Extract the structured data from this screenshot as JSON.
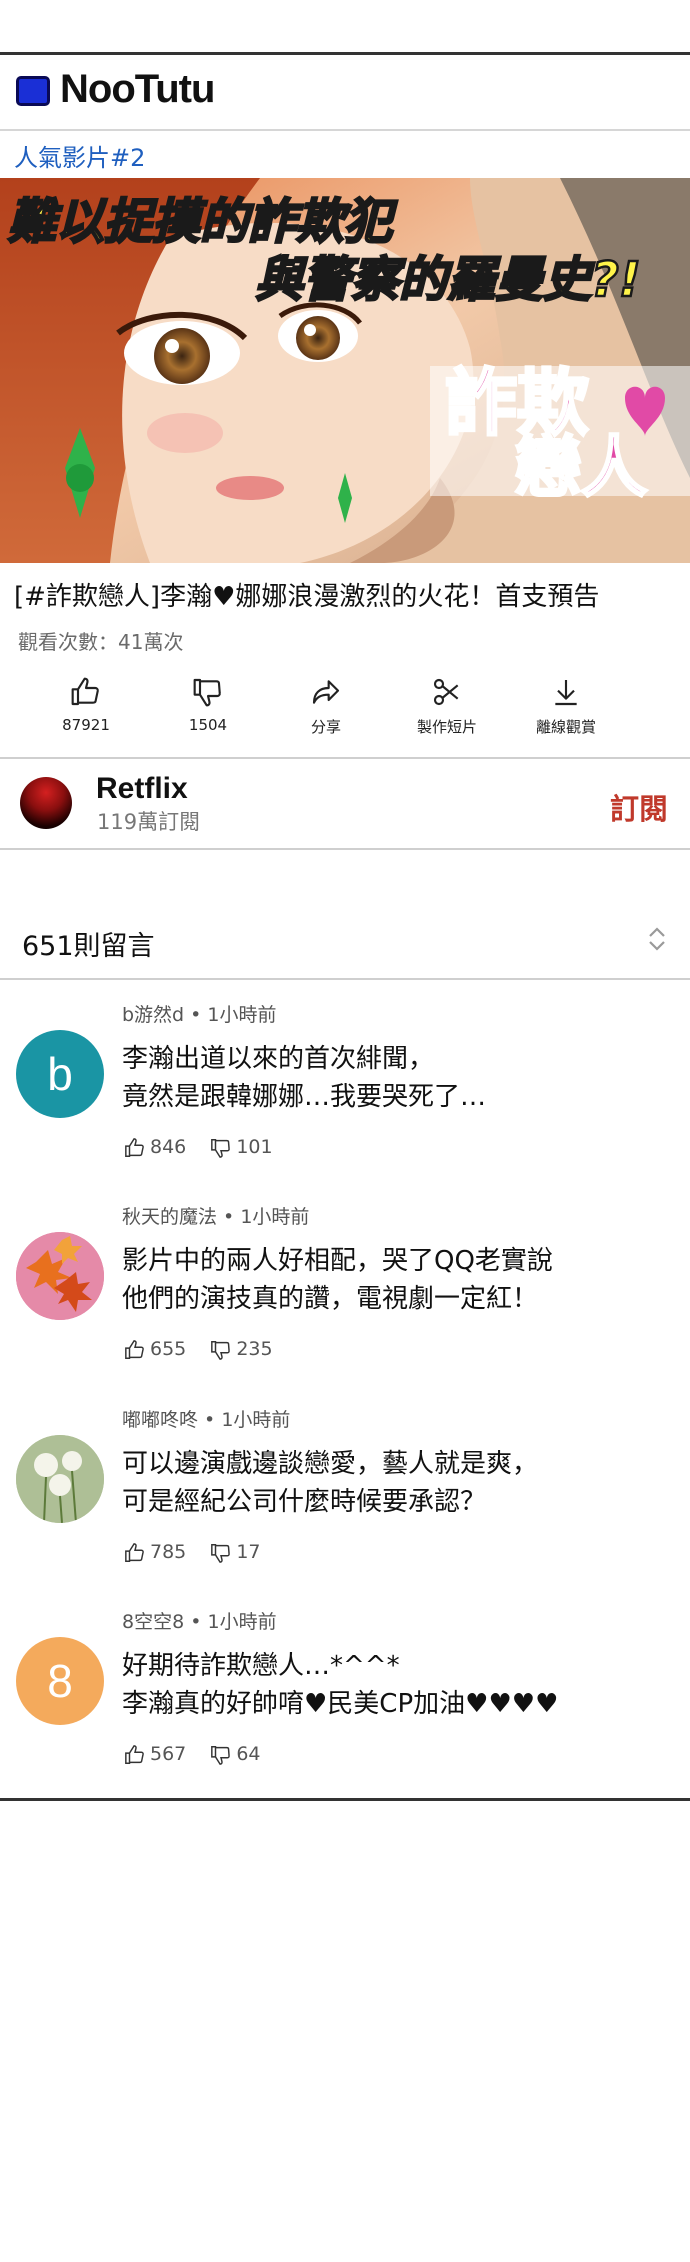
{
  "app": {
    "title": "NooTutu"
  },
  "section": {
    "label": "人氣影片#2"
  },
  "hero": {
    "headline_line1": "難以捉摸的詐欺犯",
    "headline_line2": "與警察的羅曼史?!",
    "logo_line1": "詐欺",
    "logo_line2": "戀人"
  },
  "video": {
    "title": "[#詐欺戀人]李瀚♥娜娜浪漫激烈的火花！首支預告",
    "views": "觀看次數：41萬次"
  },
  "actions": [
    {
      "icon": "thumbs-up-icon",
      "label": "87921"
    },
    {
      "icon": "thumbs-down-icon",
      "label": "1504"
    },
    {
      "icon": "share-icon",
      "label": "分享"
    },
    {
      "icon": "clip-icon",
      "label": "製作短片"
    },
    {
      "icon": "download-icon",
      "label": "離線觀賞"
    }
  ],
  "channel": {
    "name": "Retflix",
    "subscribers": "119萬訂閱",
    "subscribe_label": "訂閱"
  },
  "comments_header": {
    "count_label": "651則留言"
  },
  "comments": [
    {
      "author": "b游然d",
      "time": "1小時前",
      "avatar_letter": "b",
      "avatar_color": "#1a95a4",
      "line1": "李瀚出道以來的首次緋聞，",
      "line2": "竟然是跟韓娜娜…我要哭死了…",
      "likes": "846",
      "dislikes": "101"
    },
    {
      "author": "秋天的魔法",
      "time": "1小時前",
      "avatar_letter": "",
      "avatar_color": "#e07a9a",
      "line1": "影片中的兩人好相配，哭了QQ老實說",
      "line2": "他們的演技真的讚，電視劇一定紅！",
      "likes": "655",
      "dislikes": "235"
    },
    {
      "author": "嘟嘟咚咚",
      "time": "1小時前",
      "avatar_letter": "",
      "avatar_color": "#b9c7a3",
      "line1": "可以邊演戲邊談戀愛，藝人就是爽，",
      "line2": "可是經紀公司什麼時候要承認？",
      "likes": "785",
      "dislikes": "17"
    },
    {
      "author": "8空空8",
      "time": "1小時前",
      "avatar_letter": "8",
      "avatar_color": "#f4aa5c",
      "line1": "好期待詐欺戀人…*^^*",
      "line2": "李瀚真的好帥唷♥民美CP加油♥♥♥♥",
      "likes": "567",
      "dislikes": "64"
    }
  ]
}
